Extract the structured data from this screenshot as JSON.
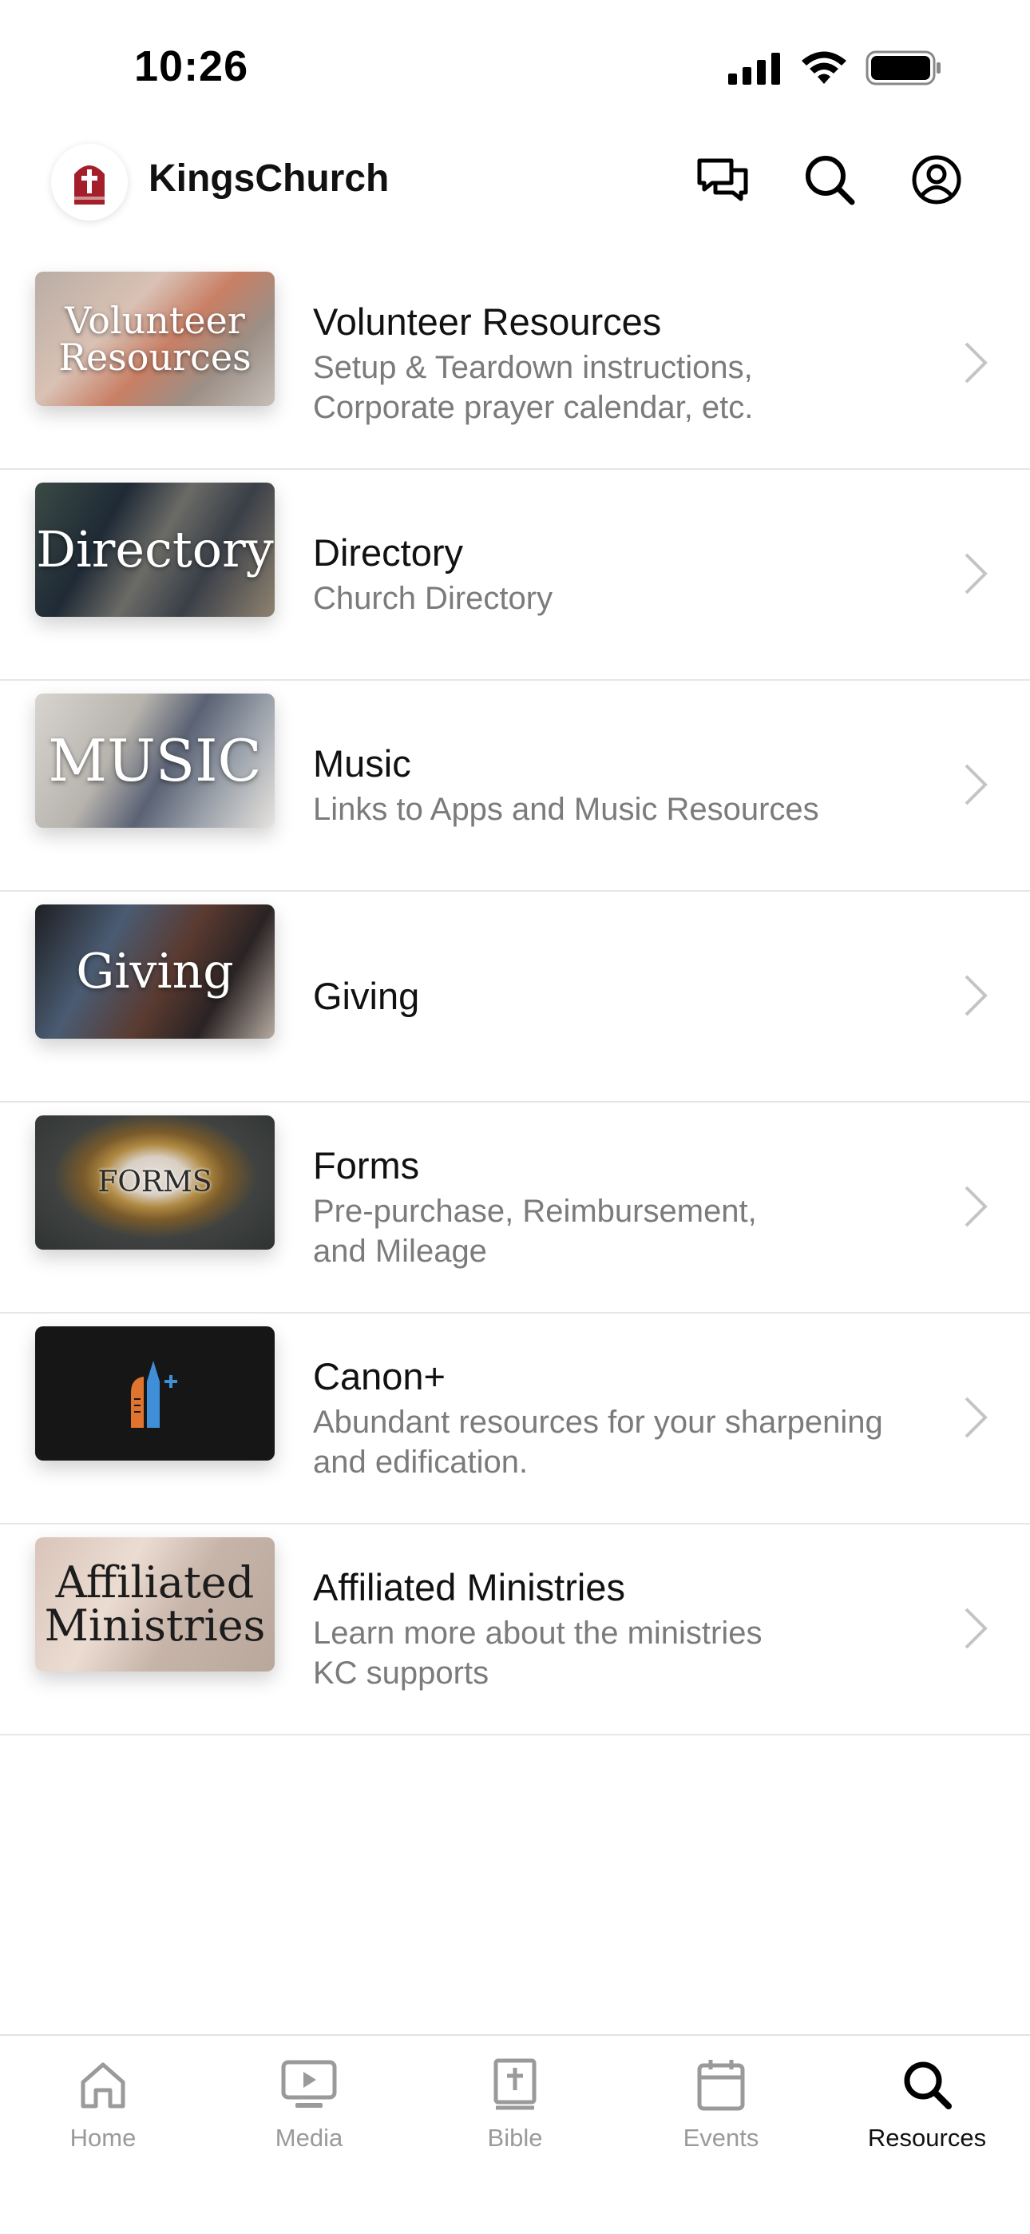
{
  "status": {
    "time": "10:26"
  },
  "header": {
    "title": "KingsChurch"
  },
  "resources": [
    {
      "title": "Volunteer Resources",
      "subtitle_lines": [
        "Setup & Teardown instructions,",
        "Corporate prayer calendar, etc."
      ],
      "thumb_text": [
        "Volunteer",
        "Resources"
      ]
    },
    {
      "title": "Directory",
      "subtitle_lines": [
        "Church Directory"
      ],
      "thumb_text": [
        "Directory"
      ]
    },
    {
      "title": "Music",
      "subtitle_lines": [
        "Links to Apps and Music Resources"
      ],
      "thumb_text": [
        "MUSIC"
      ]
    },
    {
      "title": "Giving",
      "subtitle_lines": [],
      "thumb_text": [
        "Giving"
      ]
    },
    {
      "title": "Forms",
      "subtitle_lines": [
        "Pre-purchase, Reimbursement,",
        "and Mileage"
      ],
      "thumb_text": [
        "FORMS"
      ]
    },
    {
      "title": "Canon+",
      "subtitle_lines": [
        "Abundant resources for your sharpening",
        "and edification."
      ],
      "thumb_text": []
    },
    {
      "title": "Affiliated Ministries",
      "subtitle_lines": [
        "Learn more about the ministries",
        "KC supports"
      ],
      "thumb_text": [
        "Affiliated",
        "Ministries"
      ]
    }
  ],
  "tabs": [
    {
      "label": "Home",
      "icon": "home-icon",
      "active": false
    },
    {
      "label": "Media",
      "icon": "media-icon",
      "active": false
    },
    {
      "label": "Bible",
      "icon": "bible-icon",
      "active": false
    },
    {
      "label": "Events",
      "icon": "calendar-icon",
      "active": false
    },
    {
      "label": "Resources",
      "icon": "search-icon",
      "active": true
    }
  ],
  "colors": {
    "text_primary": "#111111",
    "text_secondary": "#7b7b7b",
    "tab_inactive": "#9a9a9a",
    "logo_red": "#a3202a",
    "canon_blue": "#3f8fd8",
    "canon_orange": "#e0742f"
  }
}
